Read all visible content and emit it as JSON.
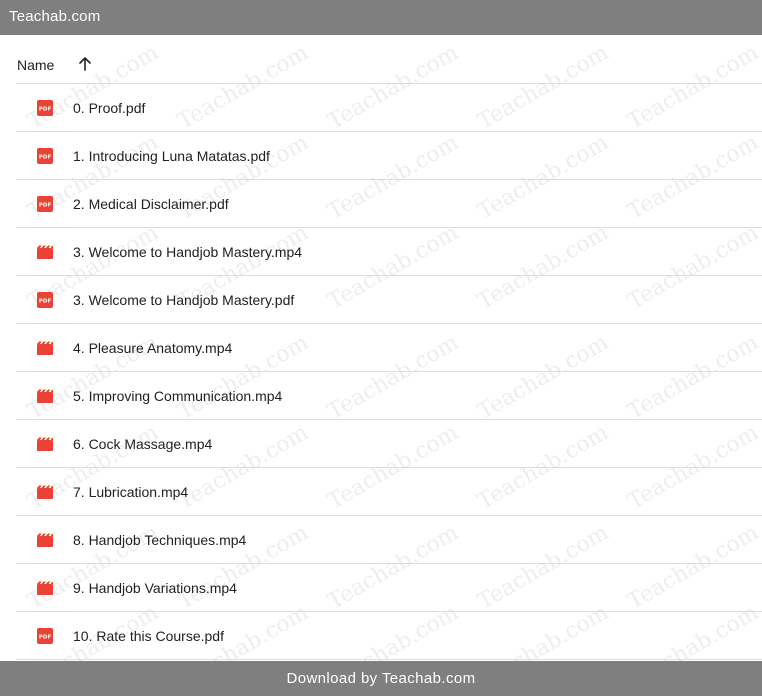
{
  "topbar": {
    "title": "Teachab.com"
  },
  "header": {
    "name_label": "Name",
    "sort_icon": "arrow-up-icon"
  },
  "files": [
    {
      "name": "0. Proof.pdf",
      "type": "pdf",
      "icon": "pdf-icon"
    },
    {
      "name": "1. Introducing Luna Matatas.pdf",
      "type": "pdf",
      "icon": "pdf-icon"
    },
    {
      "name": "2. Medical Disclaimer.pdf",
      "type": "pdf",
      "icon": "pdf-icon"
    },
    {
      "name": "3. Welcome to Handjob Mastery.mp4",
      "type": "video",
      "icon": "video-icon"
    },
    {
      "name": "3. Welcome to Handjob Mastery.pdf",
      "type": "pdf",
      "icon": "pdf-icon"
    },
    {
      "name": "4. Pleasure Anatomy.mp4",
      "type": "video",
      "icon": "video-icon"
    },
    {
      "name": "5. Improving Communication.mp4",
      "type": "video",
      "icon": "video-icon"
    },
    {
      "name": "6. Cock Massage.mp4",
      "type": "video",
      "icon": "video-icon"
    },
    {
      "name": "7. Lubrication.mp4",
      "type": "video",
      "icon": "video-icon"
    },
    {
      "name": "8. Handjob Techniques.mp4",
      "type": "video",
      "icon": "video-icon"
    },
    {
      "name": "9. Handjob Variations.mp4",
      "type": "video",
      "icon": "video-icon"
    },
    {
      "name": "10. Rate this Course.pdf",
      "type": "pdf",
      "icon": "pdf-icon"
    }
  ],
  "watermark": {
    "text": "Teachab.com"
  },
  "footer": {
    "text": "Download by Teachab.com"
  },
  "colors": {
    "bar": "#7f7f7f",
    "icon_red": "#ea4335",
    "divider": "#dadce0",
    "text": "#202124"
  }
}
